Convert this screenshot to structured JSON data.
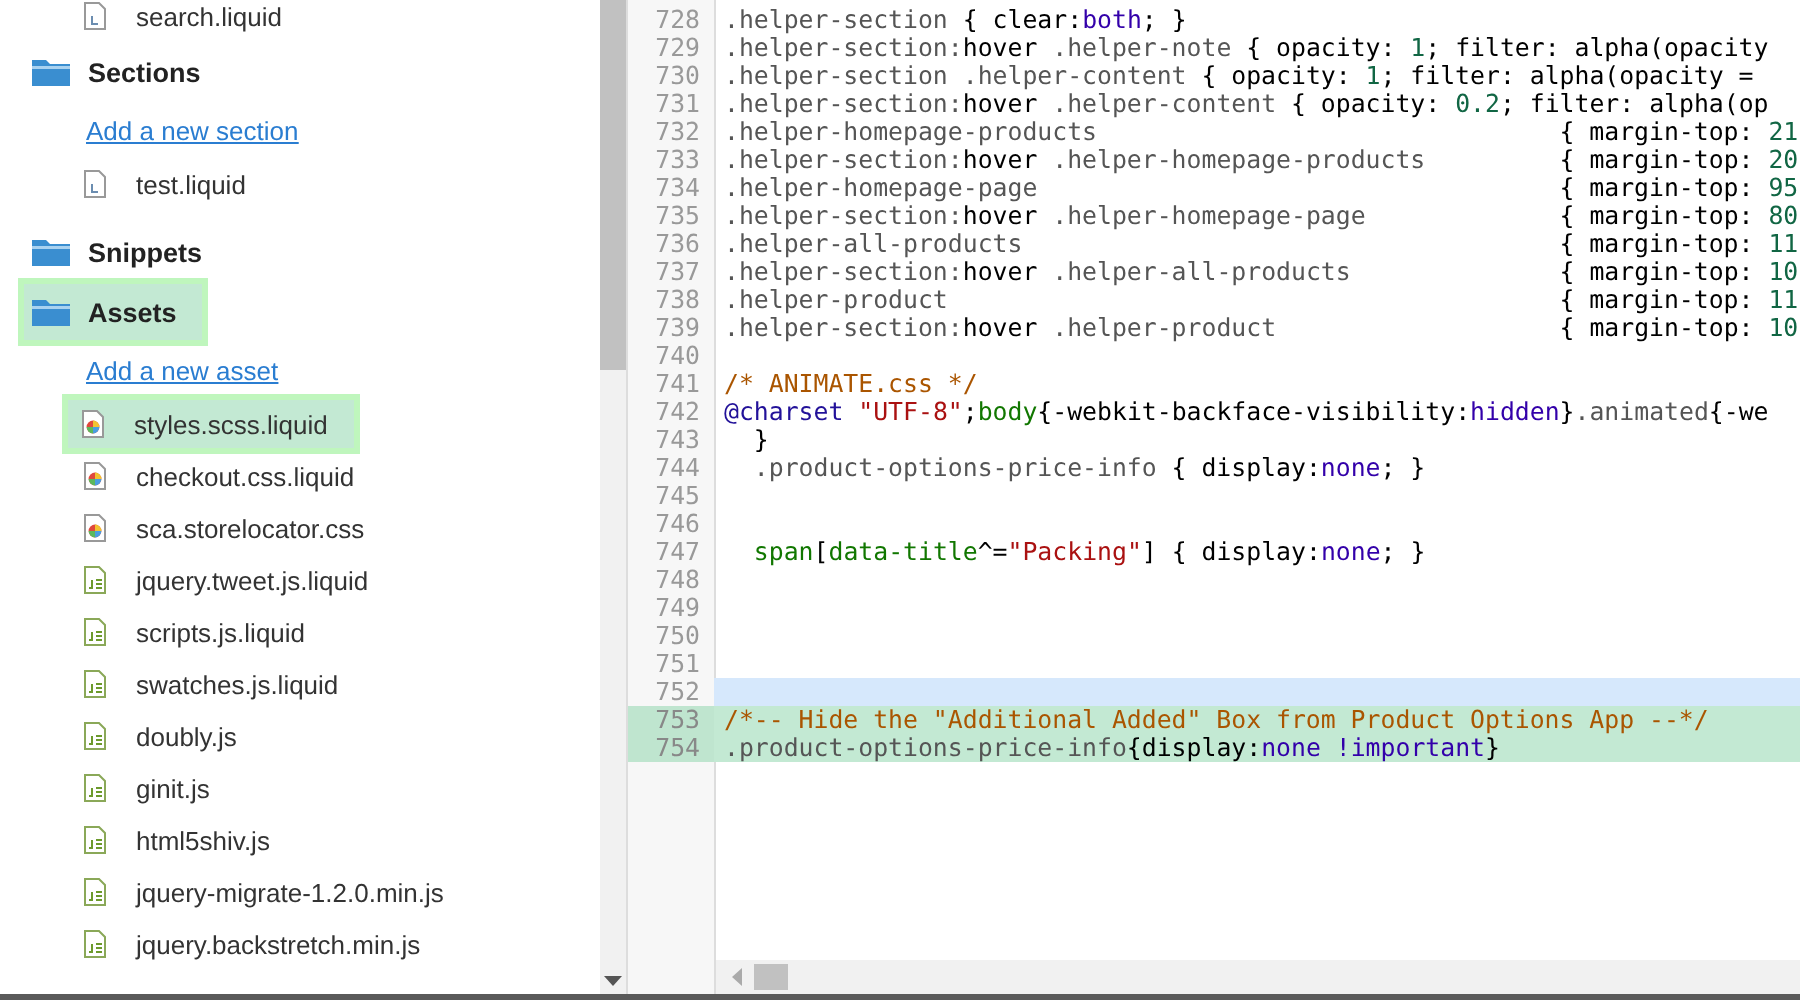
{
  "tree": [
    {
      "kind": "liquid-file",
      "label": "search.liquid",
      "marked": false
    },
    {
      "kind": "folder",
      "label": "Sections",
      "marked": false,
      "children": [
        {
          "kind": "link",
          "label": "Add a new section",
          "marked": false
        },
        {
          "kind": "liquid-file",
          "label": "test.liquid",
          "marked": false
        }
      ]
    },
    {
      "kind": "folder",
      "label": "Snippets",
      "marked": false
    },
    {
      "kind": "folder",
      "label": "Assets",
      "marked": true,
      "children": [
        {
          "kind": "link",
          "label": "Add a new asset",
          "marked": false
        },
        {
          "kind": "css-file",
          "label": "styles.scss.liquid",
          "marked": true
        },
        {
          "kind": "css-file",
          "label": "checkout.css.liquid",
          "marked": false
        },
        {
          "kind": "css-file",
          "label": "sca.storelocator.css",
          "marked": false
        },
        {
          "kind": "js-file",
          "label": "jquery.tweet.js.liquid",
          "marked": false
        },
        {
          "kind": "js-file",
          "label": "scripts.js.liquid",
          "marked": false
        },
        {
          "kind": "js-file",
          "label": "swatches.js.liquid",
          "marked": false
        },
        {
          "kind": "js-file",
          "label": "doubly.js",
          "marked": false
        },
        {
          "kind": "js-file",
          "label": "ginit.js",
          "marked": false
        },
        {
          "kind": "js-file",
          "label": "html5shiv.js",
          "marked": false
        },
        {
          "kind": "js-file",
          "label": "jquery-migrate-1.2.0.min.js",
          "marked": false
        },
        {
          "kind": "js-file",
          "label": "jquery.backstretch.min.js",
          "marked": false
        }
      ]
    }
  ],
  "code": {
    "lines": [
      {
        "number": "728",
        "active": false,
        "marked": false,
        "tokens": [
          {
            "kind": "sel",
            "text": ".helper-section "
          },
          {
            "kind": "punct",
            "text": "{ "
          },
          {
            "kind": "prop",
            "text": "clear"
          },
          {
            "kind": "punct",
            "text": ":"
          },
          {
            "kind": "val",
            "text": "both"
          },
          {
            "kind": "punct",
            "text": "; }"
          }
        ]
      },
      {
        "number": "729",
        "active": false,
        "marked": false,
        "tokens": [
          {
            "kind": "sel",
            "text": ".helper-section:"
          },
          {
            "kind": "prop",
            "text": "hover"
          },
          {
            "kind": "sel",
            "text": " .helper-note "
          },
          {
            "kind": "punct",
            "text": "{ "
          },
          {
            "kind": "prop",
            "text": "opacity"
          },
          {
            "kind": "punct",
            "text": ": "
          },
          {
            "kind": "num",
            "text": "1"
          },
          {
            "kind": "punct",
            "text": "; "
          },
          {
            "kind": "prop",
            "text": "filter"
          },
          {
            "kind": "punct",
            "text": ": "
          },
          {
            "kind": "prop",
            "text": "alpha(opacity"
          }
        ]
      },
      {
        "number": "730",
        "active": false,
        "marked": false,
        "tokens": [
          {
            "kind": "sel",
            "text": ".helper-section .helper-content "
          },
          {
            "kind": "punct",
            "text": "{ "
          },
          {
            "kind": "prop",
            "text": "opacity"
          },
          {
            "kind": "punct",
            "text": ": "
          },
          {
            "kind": "num",
            "text": "1"
          },
          {
            "kind": "punct",
            "text": "; "
          },
          {
            "kind": "prop",
            "text": "filter"
          },
          {
            "kind": "punct",
            "text": ": "
          },
          {
            "kind": "prop",
            "text": "alpha(opacity ="
          }
        ]
      },
      {
        "number": "731",
        "active": false,
        "marked": false,
        "tokens": [
          {
            "kind": "sel",
            "text": ".helper-section:"
          },
          {
            "kind": "prop",
            "text": "hover"
          },
          {
            "kind": "sel",
            "text": " .helper-content "
          },
          {
            "kind": "punct",
            "text": "{ "
          },
          {
            "kind": "prop",
            "text": "opacity"
          },
          {
            "kind": "punct",
            "text": ": "
          },
          {
            "kind": "num",
            "text": "0.2"
          },
          {
            "kind": "punct",
            "text": "; "
          },
          {
            "kind": "prop",
            "text": "filter"
          },
          {
            "kind": "punct",
            "text": ": "
          },
          {
            "kind": "prop",
            "text": "alpha(op"
          }
        ]
      },
      {
        "number": "732",
        "active": false,
        "marked": false,
        "tokens": [
          {
            "kind": "sel",
            "text": ".helper-homepage-products                               "
          },
          {
            "kind": "punct",
            "text": "{ "
          },
          {
            "kind": "prop",
            "text": "margin-top"
          },
          {
            "kind": "punct",
            "text": ": "
          },
          {
            "kind": "num",
            "text": "21"
          }
        ]
      },
      {
        "number": "733",
        "active": false,
        "marked": false,
        "tokens": [
          {
            "kind": "sel",
            "text": ".helper-section:"
          },
          {
            "kind": "prop",
            "text": "hover"
          },
          {
            "kind": "sel",
            "text": " .helper-homepage-products         "
          },
          {
            "kind": "punct",
            "text": "{ "
          },
          {
            "kind": "prop",
            "text": "margin-top"
          },
          {
            "kind": "punct",
            "text": ": "
          },
          {
            "kind": "num",
            "text": "20"
          }
        ]
      },
      {
        "number": "734",
        "active": false,
        "marked": false,
        "tokens": [
          {
            "kind": "sel",
            "text": ".helper-homepage-page                                   "
          },
          {
            "kind": "punct",
            "text": "{ "
          },
          {
            "kind": "prop",
            "text": "margin-top"
          },
          {
            "kind": "punct",
            "text": ": "
          },
          {
            "kind": "num",
            "text": "95"
          }
        ]
      },
      {
        "number": "735",
        "active": false,
        "marked": false,
        "tokens": [
          {
            "kind": "sel",
            "text": ".helper-section:"
          },
          {
            "kind": "prop",
            "text": "hover"
          },
          {
            "kind": "sel",
            "text": " .helper-homepage-page             "
          },
          {
            "kind": "punct",
            "text": "{ "
          },
          {
            "kind": "prop",
            "text": "margin-top"
          },
          {
            "kind": "punct",
            "text": ": "
          },
          {
            "kind": "num",
            "text": "80"
          }
        ]
      },
      {
        "number": "736",
        "active": false,
        "marked": false,
        "tokens": [
          {
            "kind": "sel",
            "text": ".helper-all-products                                    "
          },
          {
            "kind": "punct",
            "text": "{ "
          },
          {
            "kind": "prop",
            "text": "margin-top"
          },
          {
            "kind": "punct",
            "text": ": "
          },
          {
            "kind": "num",
            "text": "11"
          }
        ]
      },
      {
        "number": "737",
        "active": false,
        "marked": false,
        "tokens": [
          {
            "kind": "sel",
            "text": ".helper-section:"
          },
          {
            "kind": "prop",
            "text": "hover"
          },
          {
            "kind": "sel",
            "text": " .helper-all-products              "
          },
          {
            "kind": "punct",
            "text": "{ "
          },
          {
            "kind": "prop",
            "text": "margin-top"
          },
          {
            "kind": "punct",
            "text": ": "
          },
          {
            "kind": "num",
            "text": "10"
          }
        ]
      },
      {
        "number": "738",
        "active": false,
        "marked": false,
        "tokens": [
          {
            "kind": "sel",
            "text": ".helper-product                                         "
          },
          {
            "kind": "punct",
            "text": "{ "
          },
          {
            "kind": "prop",
            "text": "margin-top"
          },
          {
            "kind": "punct",
            "text": ": "
          },
          {
            "kind": "num",
            "text": "11"
          }
        ]
      },
      {
        "number": "739",
        "active": false,
        "marked": false,
        "tokens": [
          {
            "kind": "sel",
            "text": ".helper-section:"
          },
          {
            "kind": "prop",
            "text": "hover"
          },
          {
            "kind": "sel",
            "text": " .helper-product                   "
          },
          {
            "kind": "punct",
            "text": "{ "
          },
          {
            "kind": "prop",
            "text": "margin-top"
          },
          {
            "kind": "punct",
            "text": ": "
          },
          {
            "kind": "num",
            "text": "10"
          }
        ]
      },
      {
        "number": "740",
        "active": false,
        "marked": false
      },
      {
        "number": "741",
        "active": false,
        "marked": false,
        "tokens": [
          {
            "kind": "com",
            "text": "/* ANIMATE.css */"
          }
        ]
      },
      {
        "number": "742",
        "active": false,
        "marked": false,
        "tokens": [
          {
            "kind": "atrule",
            "text": "@charset "
          },
          {
            "kind": "str",
            "text": "\"UTF-8\""
          },
          {
            "kind": "punct",
            "text": ";"
          },
          {
            "kind": "tag",
            "text": "body"
          },
          {
            "kind": "punct",
            "text": "{"
          },
          {
            "kind": "prop",
            "text": "-webkit-backface-visibility"
          },
          {
            "kind": "punct",
            "text": ":"
          },
          {
            "kind": "val",
            "text": "hidden"
          },
          {
            "kind": "punct",
            "text": "}"
          },
          {
            "kind": "sel",
            "text": ".animated"
          },
          {
            "kind": "punct",
            "text": "{-we"
          }
        ]
      },
      {
        "number": "743",
        "active": false,
        "marked": false,
        "tokens": [
          {
            "kind": "punct",
            "text": "  }"
          }
        ]
      },
      {
        "number": "744",
        "active": false,
        "marked": false,
        "tokens": [
          {
            "kind": "sel",
            "text": "  .product-options-price-info "
          },
          {
            "kind": "punct",
            "text": "{ "
          },
          {
            "kind": "prop",
            "text": "display"
          },
          {
            "kind": "punct",
            "text": ":"
          },
          {
            "kind": "val",
            "text": "none"
          },
          {
            "kind": "punct",
            "text": "; }"
          }
        ]
      },
      {
        "number": "745",
        "active": false,
        "marked": false
      },
      {
        "number": "746",
        "active": false,
        "marked": false
      },
      {
        "number": "747",
        "active": false,
        "marked": false,
        "tokens": [
          {
            "kind": "tag",
            "text": "  span"
          },
          {
            "kind": "punct",
            "text": "["
          },
          {
            "kind": "tag",
            "text": "data-title"
          },
          {
            "kind": "punct",
            "text": "^="
          },
          {
            "kind": "str",
            "text": "\"Packing\""
          },
          {
            "kind": "punct",
            "text": "] { "
          },
          {
            "kind": "prop",
            "text": "display"
          },
          {
            "kind": "punct",
            "text": ":"
          },
          {
            "kind": "val",
            "text": "none"
          },
          {
            "kind": "punct",
            "text": "; }"
          }
        ]
      },
      {
        "number": "748",
        "active": false,
        "marked": false
      },
      {
        "number": "749",
        "active": false,
        "marked": false
      },
      {
        "number": "750",
        "active": false,
        "marked": false
      },
      {
        "number": "751",
        "active": false,
        "marked": false
      },
      {
        "number": "752",
        "active": true,
        "marked": false
      },
      {
        "number": "753",
        "active": false,
        "marked": true,
        "tokens": [
          {
            "kind": "com",
            "text": "/*-- Hide the \"Additional Added\" Box from Product Options App --*/"
          }
        ]
      },
      {
        "number": "754",
        "active": false,
        "marked": true,
        "tokens": [
          {
            "kind": "sel",
            "text": ".product-options-price-info"
          },
          {
            "kind": "punct",
            "text": "{"
          },
          {
            "kind": "prop",
            "text": "display"
          },
          {
            "kind": "punct",
            "text": ":"
          },
          {
            "kind": "val",
            "text": "none "
          },
          {
            "kind": "imp",
            "text": "!important"
          },
          {
            "kind": "punct",
            "text": "}"
          }
        ]
      }
    ]
  }
}
